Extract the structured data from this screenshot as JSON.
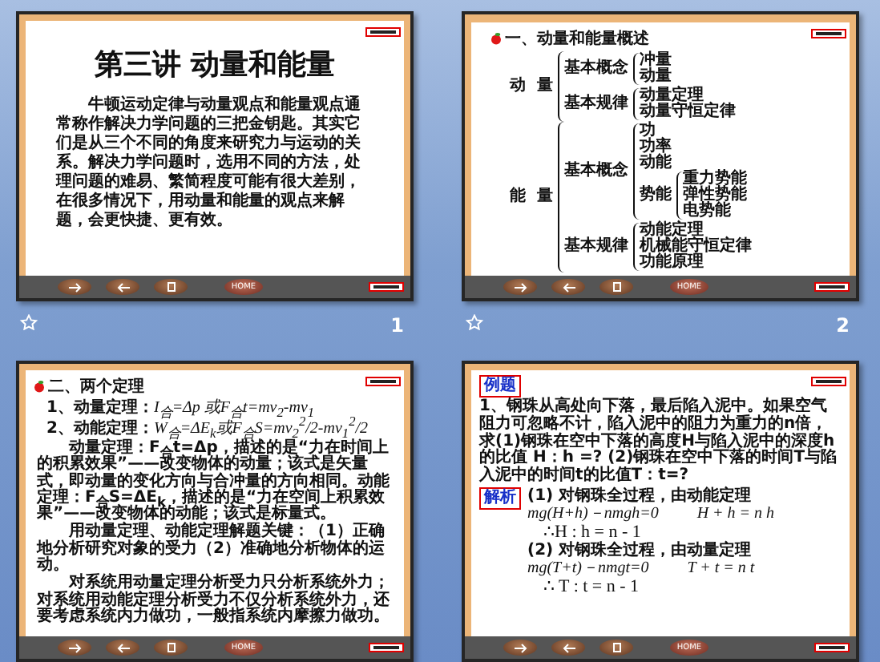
{
  "slides": [
    {
      "kind": "title",
      "number": "1",
      "bullet_icon": false,
      "heading": "第三讲  动量和能量",
      "paragraph": "牛顿运动定律与动量观点和能量观点通常称作解决力学问题的三把金钥匙。其实它们是从三个不同的角度来研究力与运动的关系。解决力学问题时，选用不同的方法，处理问题的难易、繁简程度可能有很大差别，在很多情况下，用动量和能量的观点来解题，会更快捷、更有效。",
      "nav_buttons": [
        {
          "kind": "next"
        },
        {
          "kind": "prev"
        },
        {
          "kind": "stop"
        },
        {
          "kind": "home",
          "label": "HOME"
        }
      ]
    },
    {
      "kind": "tree",
      "number": "2",
      "bullet_icon": true,
      "heading": "一、动量和能量概述",
      "tree": [
        {
          "label": "动  量",
          "children": [
            {
              "label": "基本概念",
              "children": [
                {
                  "label": "冲量"
                },
                {
                  "label": "动量"
                }
              ]
            },
            {
              "label": "基本规律",
              "children": [
                {
                  "label": "动量定理"
                },
                {
                  "label": "动量守恒定律"
                }
              ]
            }
          ]
        },
        {
          "label": "能  量",
          "children": [
            {
              "label": "基本概念",
              "children": [
                {
                  "label": "功"
                },
                {
                  "label": "功率"
                },
                {
                  "label": "动能"
                },
                {
                  "label": "势能",
                  "children": [
                    {
                      "label": "重力势能"
                    },
                    {
                      "label": "弹性势能"
                    },
                    {
                      "label": "电势能"
                    }
                  ]
                }
              ]
            },
            {
              "label": "基本规律",
              "children": [
                {
                  "label": "动能定理"
                },
                {
                  "label": "机械能守恒定律"
                },
                {
                  "label": "功能原理"
                }
              ]
            }
          ]
        }
      ],
      "nav_buttons": [
        {
          "kind": "next"
        },
        {
          "kind": "prev"
        },
        {
          "kind": "stop"
        },
        {
          "kind": "home",
          "label": "HOME"
        }
      ]
    },
    {
      "kind": "theorems",
      "bullet_icon": true,
      "heading": "二、两个定理",
      "theorems": [
        {
          "label": "1、动量定理：",
          "formula": "I$_{合}$=Δp 或F$_{合}$t=mv$_{2}$-mv$_{1}$"
        },
        {
          "label": "2、动能定理：",
          "formula": "W$_{合}$=ΔE$_{k}$或F$_{合}$S=mv$_{2}$$^{2}$/2-mv$_{1}$$^{2}$/2"
        }
      ],
      "paragraphs": [
        "动量定理：F$_{合}$t=Δp，描述的是“力在时间上的积累效果”——改变物体的动量；该式是矢量式，即动量的变化方向与合冲量的方向相同。动能定理：F$_{合}$S=ΔE$_{k}$，描述的是“力在空间上积累效果”——改变物体的动能；该式是标量式。",
        "用动量定理、动能定理解题关键：（1）正确地分析研究对象的受力（2）准确地分析物体的运动。",
        "对系统用动量定理分析受力只分析系统外力；对系统用动能定理分析受力不仅分析系统外力，还要考虑系统内力做功，一般指系统内摩擦力做功。"
      ],
      "nav_buttons": [
        {
          "kind": "next"
        },
        {
          "kind": "prev"
        },
        {
          "kind": "stop"
        },
        {
          "kind": "home",
          "label": "HOME"
        }
      ]
    },
    {
      "kind": "example",
      "bullet_icon": false,
      "heading": "例题",
      "question": "1、钢珠从高处向下落，最后陷入泥中。如果空气阻力可忽略不计，陷入泥中的阻力为重力的n倍，求(1)钢珠在空中下落的高度H与陷入泥中的深度h的比值 H：h =? (2)钢珠在空中下落的时间T与陷入泥中的时间t的比值T：t=?",
      "answer_label": "解析",
      "steps": [
        {
          "kind": "step",
          "text": "(1) 对钢珠全过程，由动能定理"
        },
        {
          "kind": "equation",
          "parts": [
            "mg(H+h)－nmgh=0",
            "H + h = n h"
          ]
        },
        {
          "kind": "conclusion",
          "text": "∴H : h = n - 1"
        },
        {
          "kind": "step",
          "text": "(2) 对钢珠全过程，由动量定理"
        },
        {
          "kind": "equation",
          "parts": [
            "mg(T+t)－nmgt=0",
            "T + t = n t"
          ]
        },
        {
          "kind": "conclusion",
          "text": "∴ T : t = n - 1"
        }
      ],
      "nav_buttons": [
        {
          "kind": "next"
        },
        {
          "kind": "prev"
        },
        {
          "kind": "stop"
        },
        {
          "kind": "home",
          "label": "HOME"
        }
      ]
    }
  ]
}
